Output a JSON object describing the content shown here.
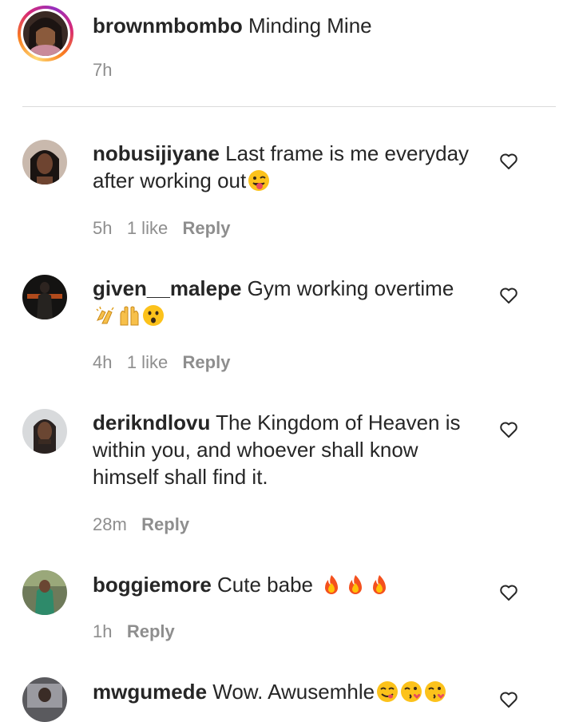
{
  "caption": {
    "username": "brownmbombo",
    "text": "Minding Mine",
    "time": "7h"
  },
  "comments": [
    {
      "username": "nobusijiyane",
      "line1": "Last frame is me everyday",
      "line2": "after working out",
      "time": "5h",
      "likes": "1 like",
      "reply": "Reply"
    },
    {
      "username": "given__malepe",
      "line1": "Gym working overtime",
      "time": "4h",
      "likes": "1 like",
      "reply": "Reply"
    },
    {
      "username": "derikndlovu",
      "line1": "The Kingdom of Heaven is",
      "line2": "within you, and whoever shall know",
      "line3": "himself shall find it.",
      "time": "28m",
      "reply": "Reply"
    },
    {
      "username": "boggiemore",
      "line1": "Cute babe",
      "time": "1h",
      "reply": "Reply"
    },
    {
      "username": "mwgumede",
      "line1": "Wow. Awusemhle"
    }
  ],
  "icons": {
    "like": "heart-outline-icon",
    "tongue": "winking-face-with-tongue-emoji",
    "clap": "clapping-hands-emoji",
    "raised": "raising-hands-emoji",
    "surprised": "hushed-face-emoji",
    "fire": "fire-emoji",
    "yum": "face-savoring-food-emoji",
    "kiss": "face-blowing-kiss-emoji"
  },
  "colors": {
    "text": "#262626",
    "secondary": "#8e8e8e",
    "divider": "#dbdbdb"
  }
}
